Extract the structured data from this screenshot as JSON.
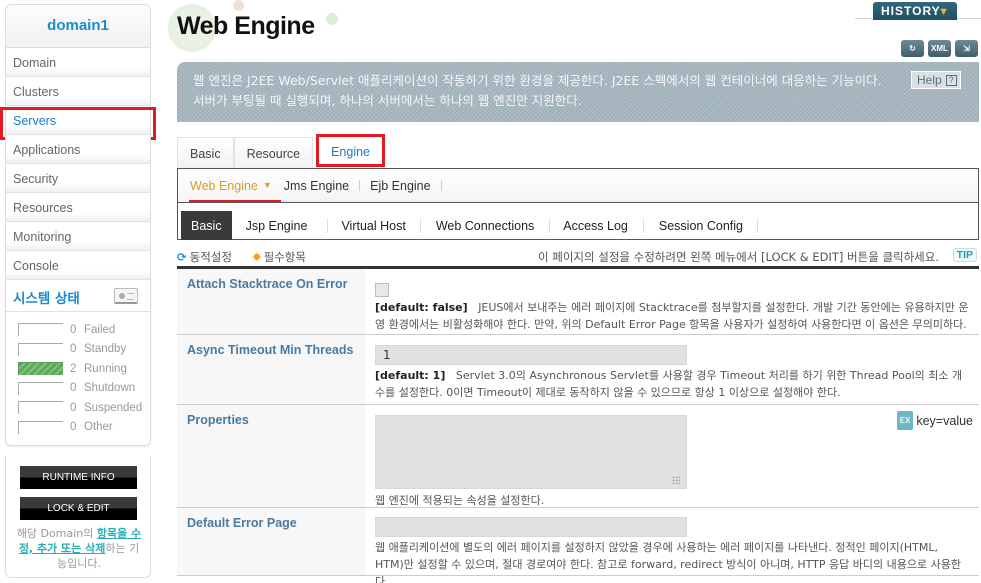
{
  "sidebar": {
    "domain_name": "domain1",
    "nav_items": [
      {
        "label": "Domain"
      },
      {
        "label": "Clusters"
      },
      {
        "label": "Servers",
        "active": true
      },
      {
        "label": "Applications"
      },
      {
        "label": "Security"
      },
      {
        "label": "Resources"
      },
      {
        "label": "Monitoring"
      },
      {
        "label": "Console"
      }
    ],
    "system_status": {
      "title": "시스템 상태",
      "rows": [
        {
          "count": "0",
          "label": "Failed"
        },
        {
          "count": "0",
          "label": "Standby"
        },
        {
          "count": "2",
          "label": "Running"
        },
        {
          "count": "0",
          "label": "Shutdown"
        },
        {
          "count": "0",
          "label": "Suspended"
        },
        {
          "count": "0",
          "label": "Other"
        }
      ]
    },
    "runtime_info_label": "RUNTIME INFO",
    "lock_edit_label": "LOCK & EDIT",
    "note_prefix": "해당 Domain의 ",
    "note_link": "항목을 수정, 추가 또는 삭제",
    "note_suffix": "하는 기능입니다."
  },
  "header": {
    "title": "Web Engine",
    "history_label": "HISTORY",
    "tool_icons": [
      "reload-icon",
      "xml-export-icon",
      "export-icon"
    ],
    "tool_icon_text": [
      "↻",
      "XML",
      "⇲"
    ],
    "description": "웹 엔진은 J2EE Web/Servlet 애플리케이션이 작동하기 위한 환경을 제공한다. J2EE 스펙에서의 웹 컨테이너에 대응하는 기능이다. 서버가 부팅될 때 실행되며, 하나의 서버에서는 하나의 웹 엔진만 지원한다.",
    "help_label": "Help",
    "help_icon": "?"
  },
  "main_tabs": [
    {
      "label": "Basic"
    },
    {
      "label": "Resource"
    },
    {
      "label": "Engine",
      "active": true
    }
  ],
  "engine_tabs": [
    {
      "label": "Web Engine",
      "active": true
    },
    {
      "label": "Jms Engine"
    },
    {
      "label": "Ejb Engine"
    }
  ],
  "sub_tabs": [
    {
      "label": "Basic",
      "active": true
    },
    {
      "label": "Jsp Engine"
    },
    {
      "label": "Virtual Host"
    },
    {
      "label": "Web Connections"
    },
    {
      "label": "Access Log"
    },
    {
      "label": "Session Config"
    }
  ],
  "legend": {
    "dynamic_label": "동적설정",
    "required_label": "필수항목",
    "tip_text": "이 페이지의 설정을 수정하려면 왼쪽 메뉴에서 [LOCK & EDIT] 버튼을 클릭하세요.",
    "tip_badge": "TIP"
  },
  "fields": {
    "attach_stacktrace": {
      "label": "Attach Stacktrace On Error",
      "checked": false,
      "default": "[default: false]",
      "description": "JEUS에서 보내주는 에러 페이지에 Stacktrace를 첨부할지를 설정한다. 개발 기간 동안에는 유용하지만 운영 환경에서는 비활성화해야 한다. 만약, 위의 Default Error Page 항목을 사용자가 설정하여 사용한다면 이 옵션은 무의미하다."
    },
    "async_timeout": {
      "label": "Async Timeout Min Threads",
      "value": "1",
      "default": "[default: 1]",
      "description": "Servlet 3.0의 Asynchronous Servlet를 사용할 경우 Timeout 처리를 하기 위한 Thread Pool의 최소 개수를 설정한다. 0이면 Timeout이 제대로 동작하지 않을 수 있으므로 항상 1 이상으로 설정해야 한다."
    },
    "properties": {
      "label": "Properties",
      "value": "",
      "example_badge": "EX",
      "example": "key=value",
      "description": "웹 엔진에 적용되는 속성을 설정한다."
    },
    "default_error_page": {
      "label": "Default Error Page",
      "value": "",
      "description": "웹 애플리케이션에 별도의 에러 페이지를 설정하지 않았을 경우에 사용하는 에러 페이지를 나타낸다. 정적인 페이지(HTML, HTM)만 설정할 수 있으며, 절대 경로여야 한다. 참고로 forward, redirect 방식이 아니며, HTTP 응답 바디의 내용으로 사용한다."
    }
  },
  "colors": {
    "accent_blue": "#1c8ad0",
    "highlight_red": "#e21a24",
    "running_green": "#5fa75a",
    "banner_gray": "#9fb0b9",
    "history_teal": "#2a5d72"
  }
}
